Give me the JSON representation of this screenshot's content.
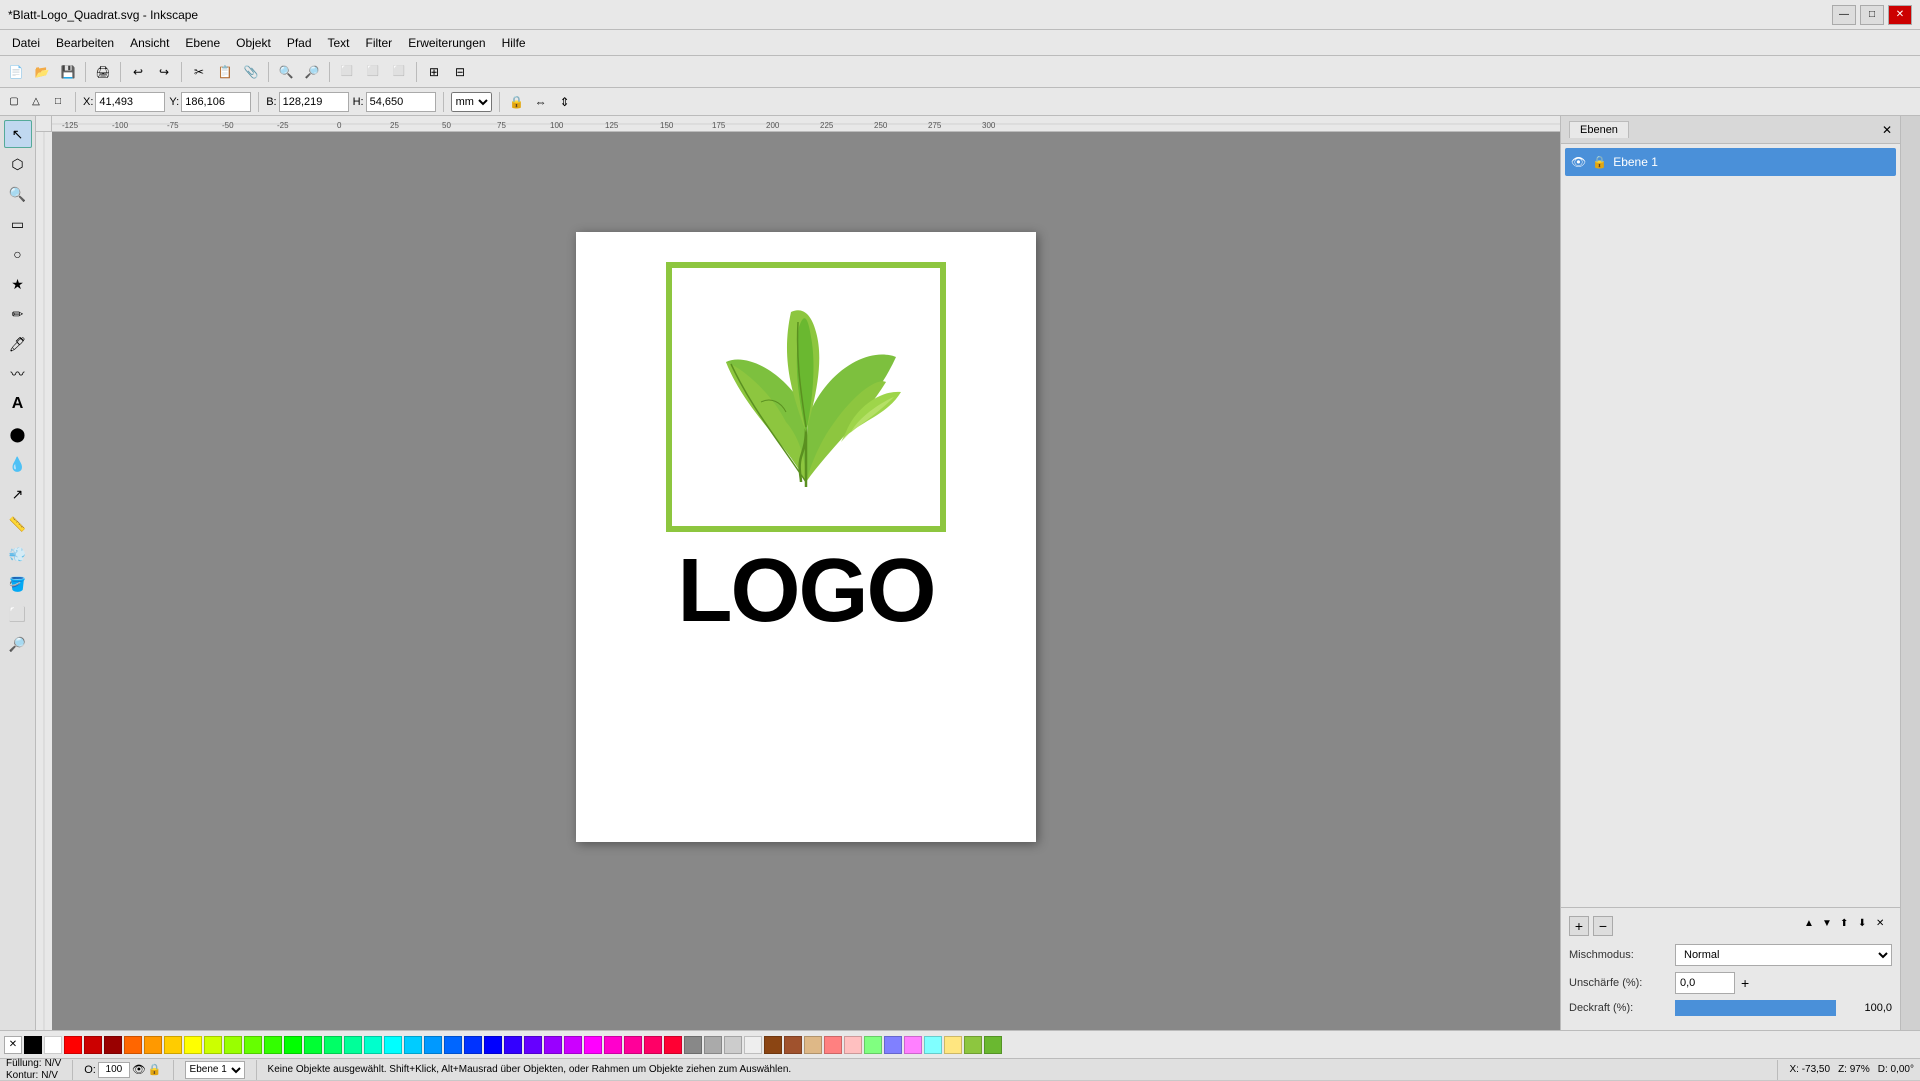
{
  "titlebar": {
    "title": "*Blatt-Logo_Quadrat.svg - Inkscape",
    "minimize": "—",
    "maximize": "□",
    "close": "✕"
  },
  "menubar": {
    "items": [
      "Datei",
      "Bearbeiten",
      "Ansicht",
      "Ebene",
      "Objekt",
      "Pfad",
      "Text",
      "Filter",
      "Erweiterungen",
      "Hilfe"
    ]
  },
  "toolbar2": {
    "x_label": "X:",
    "x_value": "41,493",
    "y_label": "Y:",
    "y_value": "186,106",
    "b_label": "B:",
    "b_value": "128,219",
    "h_label": "H:",
    "h_value": "54,650",
    "unit": "mm"
  },
  "layers": {
    "panel_title": "Ebenen",
    "close_btn": "✕",
    "layer_name": "Ebene 1"
  },
  "right_bottom": {
    "add_btn": "+",
    "remove_btn": "−",
    "blend_label": "Mischmodus:",
    "blend_value": "Normal",
    "opacity_label": "Unschärfe (%):",
    "opacity_value": "0,0",
    "opacity_plus": "+",
    "deckraft_label": "Deckraft (%):",
    "deckraft_value": "100,0"
  },
  "statusbar": {
    "fill_label": "Füllung:",
    "fill_value": "N/V",
    "kontur_label": "Kontur:",
    "kontur_value": "N/V",
    "o_label": "O:",
    "o_value": "100",
    "layer_select": "Ebene 1",
    "message": "Keine Objekte ausgewählt. Shift+Klick, Alt+Mausrad über Objekten, oder Rahmen um Objekte ziehen zum Auswählen.",
    "x_coord": "X: -73,50",
    "zoom": "Z: 97%",
    "d_label": "D:",
    "d_value": "0,00°"
  },
  "canvas": {
    "logo_text": "LOGO"
  },
  "colors": [
    "#000000",
    "#ffffff",
    "#ff0000",
    "#cc0000",
    "#990000",
    "#ff6600",
    "#ff9900",
    "#ffcc00",
    "#ffff00",
    "#ccff00",
    "#99ff00",
    "#66ff00",
    "#33ff00",
    "#00ff00",
    "#00ff33",
    "#00ff66",
    "#00ff99",
    "#00ffcc",
    "#00ffff",
    "#00ccff",
    "#0099ff",
    "#0066ff",
    "#0033ff",
    "#0000ff",
    "#3300ff",
    "#6600ff",
    "#9900ff",
    "#cc00ff",
    "#ff00ff",
    "#ff00cc",
    "#ff0099",
    "#ff0066",
    "#ff0033",
    "#888888",
    "#aaaaaa",
    "#cccccc",
    "#eeeeee",
    "#8B4513",
    "#A0522D",
    "#DEB887"
  ]
}
